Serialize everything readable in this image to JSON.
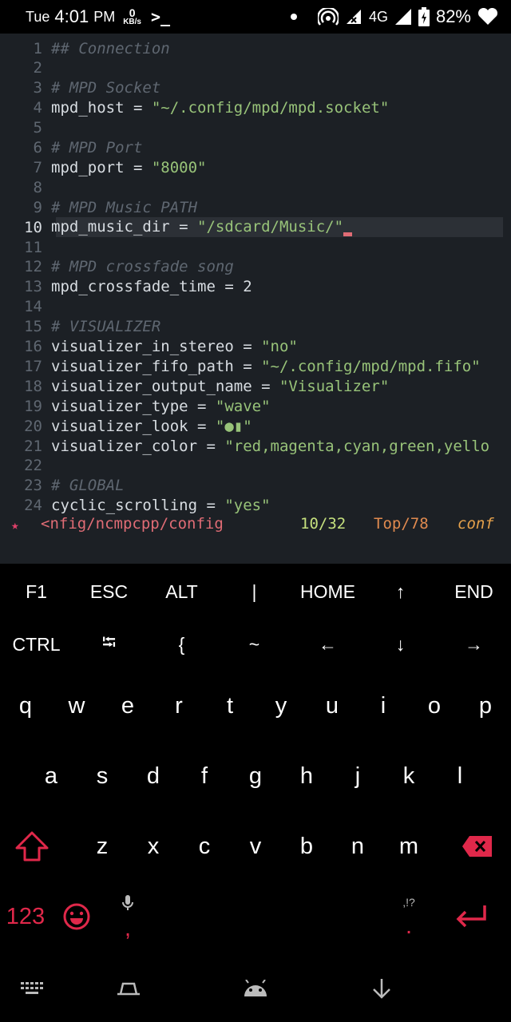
{
  "status_bar": {
    "day": "Tue",
    "time": "4:01",
    "ampm": "PM",
    "net_speed": "0",
    "net_unit": "KB/s",
    "network_type": "4G",
    "battery": "82%",
    "icons": [
      "terminal-icon",
      "dot-icon",
      "hotspot-icon",
      "signal-x-icon",
      "signal-icon",
      "battery-icon",
      "heart-icon"
    ]
  },
  "editor": {
    "lines": [
      {
        "num": "1",
        "segments": [
          {
            "t": "## Connection",
            "c": "cm"
          }
        ]
      },
      {
        "num": "2",
        "segments": []
      },
      {
        "num": "3",
        "segments": [
          {
            "t": "# MPD Socket",
            "c": "cm"
          }
        ]
      },
      {
        "num": "4",
        "segments": [
          {
            "t": "mpd_host = ",
            "c": ""
          },
          {
            "t": "\"~/.config/mpd/mpd.socket\"",
            "c": "str"
          }
        ]
      },
      {
        "num": "5",
        "segments": []
      },
      {
        "num": "6",
        "segments": [
          {
            "t": "# MPD Port",
            "c": "cm"
          }
        ]
      },
      {
        "num": "7",
        "segments": [
          {
            "t": "mpd_port = ",
            "c": ""
          },
          {
            "t": "\"8000\"",
            "c": "str"
          }
        ]
      },
      {
        "num": "8",
        "segments": []
      },
      {
        "num": "9",
        "segments": [
          {
            "t": "# MPD Music PATH",
            "c": "cm"
          }
        ]
      },
      {
        "num": "10",
        "active": true,
        "segments": [
          {
            "t": "mpd_music_dir = ",
            "c": ""
          },
          {
            "t": "\"/sdcard/Music/\"",
            "c": "str"
          }
        ]
      },
      {
        "num": "11",
        "segments": []
      },
      {
        "num": "12",
        "segments": [
          {
            "t": "# MPD crossfade song",
            "c": "cm"
          }
        ]
      },
      {
        "num": "13",
        "segments": [
          {
            "t": "mpd_crossfade_time = 2",
            "c": ""
          }
        ]
      },
      {
        "num": "14",
        "segments": []
      },
      {
        "num": "15",
        "segments": [
          {
            "t": "# VISUALIZER",
            "c": "cm"
          }
        ]
      },
      {
        "num": "16",
        "segments": [
          {
            "t": "visualizer_in_stereo = ",
            "c": ""
          },
          {
            "t": "\"no\"",
            "c": "str"
          }
        ]
      },
      {
        "num": "17",
        "segments": [
          {
            "t": "visualizer_fifo_path = ",
            "c": ""
          },
          {
            "t": "\"~/.config/mpd/mpd.fifo\"",
            "c": "str"
          }
        ]
      },
      {
        "num": "18",
        "segments": [
          {
            "t": "visualizer_output_name = ",
            "c": ""
          },
          {
            "t": "\"Visualizer\"",
            "c": "str"
          }
        ]
      },
      {
        "num": "19",
        "segments": [
          {
            "t": "visualizer_type = ",
            "c": ""
          },
          {
            "t": "\"wave\"",
            "c": "str"
          }
        ]
      },
      {
        "num": "20",
        "segments": [
          {
            "t": "visualizer_look = ",
            "c": ""
          },
          {
            "t": "\"●▮\"",
            "c": "str"
          }
        ]
      },
      {
        "num": "21",
        "segments": [
          {
            "t": "visualizer_color = ",
            "c": ""
          },
          {
            "t": "\"red,magenta,cyan,green,yello",
            "c": "str"
          }
        ]
      },
      {
        "num": "22",
        "segments": []
      },
      {
        "num": "23",
        "segments": [
          {
            "t": "# GLOBAL",
            "c": "cm"
          }
        ]
      },
      {
        "num": "24",
        "segments": [
          {
            "t": "cyclic_scrolling = ",
            "c": ""
          },
          {
            "t": "\"yes\"",
            "c": "str"
          }
        ]
      }
    ],
    "modeline": {
      "star": "★",
      "file": "<nfig/ncmpcpp/config",
      "position": "10/32",
      "scroll": "Top/78",
      "mode": "conf"
    }
  },
  "extra_keys": {
    "row1": [
      "F1",
      "ESC",
      "ALT",
      "|",
      "HOME",
      "↑",
      "END"
    ],
    "row2": [
      "CTRL",
      "⭾",
      "{",
      "~",
      "←",
      "↓",
      "→"
    ]
  },
  "keyboard": {
    "row1": [
      "q",
      "w",
      "e",
      "r",
      "t",
      "y",
      "u",
      "i",
      "o",
      "p"
    ],
    "row2": [
      "a",
      "s",
      "d",
      "f",
      "g",
      "h",
      "j",
      "k",
      "l"
    ],
    "row3": [
      "z",
      "x",
      "c",
      "v",
      "b",
      "n",
      "m"
    ],
    "numbers_key": "123",
    "comma_key": ",",
    "period_key": ".",
    "punct_hint": ",!?",
    "accent_color": "#e0284a"
  },
  "nav_bar": {
    "icons": [
      "keyboard-icon",
      "recents-icon",
      "android-icon",
      "back-down-icon"
    ]
  }
}
